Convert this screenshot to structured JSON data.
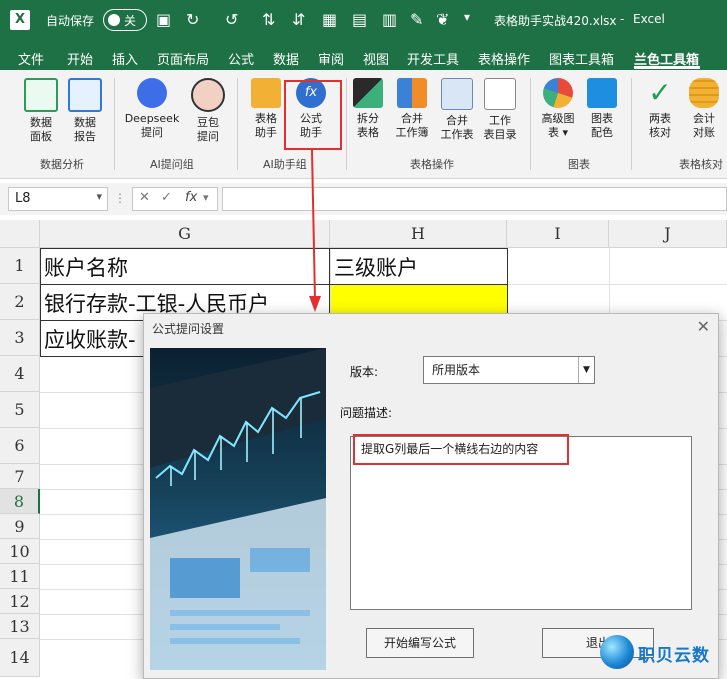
{
  "titlebar": {
    "autosave_label": "自动保存",
    "autosave_state": "关",
    "file_name": "表格助手实战420.xlsx",
    "app_sep": "-",
    "app_name": "Excel"
  },
  "menu": [
    "文件",
    "开始",
    "插入",
    "页面布局",
    "公式",
    "数据",
    "审阅",
    "视图",
    "开发工具",
    "表格操作",
    "图表工具箱",
    "兰色工具箱"
  ],
  "ribbon": {
    "buttons": [
      {
        "l1": "数据",
        "l2": "面板"
      },
      {
        "l1": "数据",
        "l2": "报告"
      },
      {
        "l1": "Deepseek",
        "l2": "提问"
      },
      {
        "l1": "豆包",
        "l2": "提问"
      },
      {
        "l1": "表格",
        "l2": "助手"
      },
      {
        "l1": "公式",
        "l2": "助手"
      },
      {
        "l1": "拆分",
        "l2": "表格"
      },
      {
        "l1": "合并",
        "l2": "工作簿"
      },
      {
        "l1": "合并",
        "l2": "工作表"
      },
      {
        "l1": "工作",
        "l2": "表目录"
      },
      {
        "l1": "高级图",
        "l2": "表 ▾"
      },
      {
        "l1": "图表",
        "l2": "配色"
      },
      {
        "l1": "两表",
        "l2": "核对"
      },
      {
        "l1": "会计",
        "l2": "对账"
      }
    ],
    "groups": [
      "数据分析",
      "AI提问组",
      "AI助手组",
      "表格操作",
      "图表",
      "表格核对"
    ]
  },
  "formula_bar": {
    "name_box": "L8",
    "fx": "fx",
    "formula": ""
  },
  "grid": {
    "columns": [
      "G",
      "H",
      "I",
      "J"
    ],
    "rows": [
      "1",
      "2",
      "3",
      "4",
      "5",
      "6",
      "7",
      "8",
      "9",
      "10",
      "11",
      "12",
      "13",
      "14"
    ],
    "cells": {
      "g1": "账户名称",
      "h1": "三级账户",
      "g2": "银行存款-工银-人民币户",
      "g3": "应收账款-"
    },
    "active_row": "8"
  },
  "dialog": {
    "title": "公式提问设置",
    "version_label": "版本:",
    "version_value": "所用版本",
    "question_label": "问题描述:",
    "question_text": "提取G列最后一个横线右边的内容",
    "start_button": "开始编写公式",
    "exit_button": "退出"
  },
  "watermark": {
    "text": "职贝云数"
  },
  "colors": {
    "excel_green": "#1e7145",
    "highlight_red": "#e03030",
    "cell_yellow": "#ffff00"
  }
}
